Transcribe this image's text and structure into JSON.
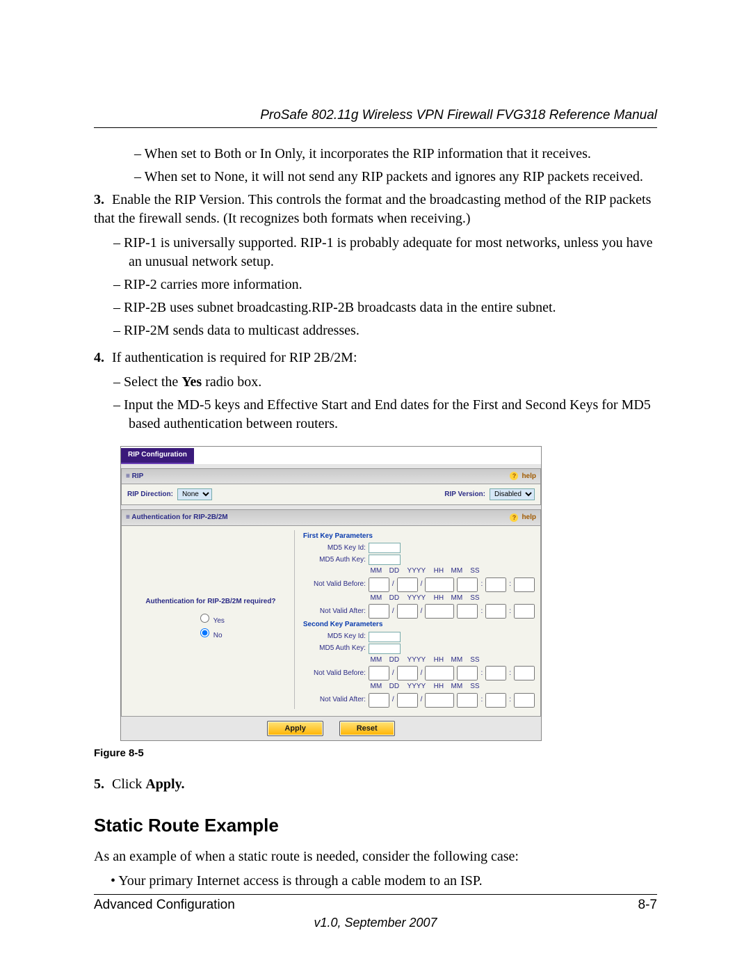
{
  "header": {
    "title": "ProSafe 802.11g Wireless VPN Firewall FVG318 Reference Manual"
  },
  "pre_items": [
    "When set to Both or In Only, it incorporates the RIP information that it receives.",
    "When set to None, it will not send any RIP packets and ignores any RIP packets received."
  ],
  "steps": {
    "s3_num": "3.",
    "s3_text": "Enable the RIP Version. This controls the format and the broadcasting method of the RIP packets that the firewall sends. (It recognizes both formats when receiving.)",
    "s3_items": [
      "RIP-1 is universally supported. RIP-1 is probably adequate for most networks, unless you have an unusual network setup.",
      "RIP-2 carries more information.",
      "RIP-2B uses subnet broadcasting.RIP-2B broadcasts data in the entire subnet.",
      "RIP-2M sends data to multicast addresses."
    ],
    "s4_num": "4.",
    "s4_text": "If authentication is required for RIP 2B/2M:",
    "s4_items_a": "Select the ",
    "s4_items_a_bold": "Yes",
    "s4_items_a_tail": " radio box.",
    "s4_items_b": "Input the MD-5 keys and Effective Start and End dates for the First and Second Keys for MD5 based authentication between routers.",
    "s5_num": "5.",
    "s5_lead": "Click ",
    "s5_bold": "Apply."
  },
  "figure": {
    "caption": "Figure 8-5",
    "tab": "RIP Configuration",
    "rip_panel": "RIP",
    "help": "help",
    "dir_label": "RIP Direction:",
    "dir_value": "None",
    "ver_label": "RIP Version:",
    "ver_value": "Disabled",
    "auth_panel": "Authentication for RIP-2B/2M",
    "auth_q": "Authentication for RIP-2B/2M required?",
    "radio_yes": "Yes",
    "radio_no": "No",
    "first_head": "First Key Parameters",
    "second_head": "Second Key Parameters",
    "k_id": "MD5 Key Id:",
    "k_auth": "MD5 Auth Key:",
    "nvb": "Not Valid Before:",
    "nva": "Not Valid After:",
    "cols": {
      "mm1": "MM",
      "dd": "DD",
      "yyyy": "YYYY",
      "hh": "HH",
      "mm2": "MM",
      "ss": "SS"
    },
    "apply": "Apply",
    "reset": "Reset"
  },
  "section_heading": "Static Route Example",
  "section_intro": "As an example of when a static route is needed, consider the following case:",
  "section_bullet": "Your primary Internet access is through a cable modem to an ISP.",
  "footer": {
    "left": "Advanced Configuration",
    "right": "8-7",
    "version": "v1.0, September 2007"
  }
}
